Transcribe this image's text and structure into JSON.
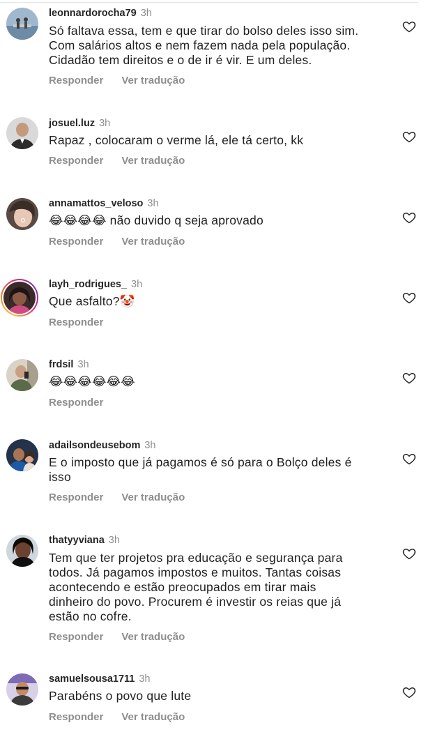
{
  "common": {
    "reply_label": "Responder",
    "translate_label": "Ver tradução",
    "heart_icon": "heart-outline-icon",
    "muted_color": "#8e8e8e"
  },
  "comments": [
    {
      "username": "leonnardorocha79",
      "time": "3h",
      "text": "Só faltava essa, tem e que tirar do bolso deles isso sim.\nCom salários altos e nem fazem nada pela população.\nCidadão tem direitos e o de ir é vir. E um deles.",
      "has_translate": true
    },
    {
      "username": "josuel.luz",
      "time": "3h",
      "text": "Rapaz , colocaram o verme lá, ele tá certo, kk",
      "has_translate": true
    },
    {
      "username": "annamattos_veloso",
      "time": "3h",
      "text": "😂😂😂😂 não duvido q seja aprovado",
      "has_translate": true
    },
    {
      "username": "layh_rodrigues_",
      "time": "3h",
      "text": "Que asfalto?🤡",
      "has_translate": false
    },
    {
      "username": "frdsil",
      "time": "3h",
      "text": "😂😂😂😂😂😂",
      "has_translate": false
    },
    {
      "username": "adailsondeusebom",
      "time": "3h",
      "text": "E o imposto que já pagamos é só para o Bolço deles é\nisso",
      "has_translate": true
    },
    {
      "username": "thatyyviana",
      "time": "3h",
      "text": "Tem que ter projetos pra educação e segurança para\ntodos. Já pagamos impostos e muitos. Tantas coisas\nacontecendo e estão preocupados em tirar mais\ndinheiro do povo. Procurem é investir os reias que já\nestão no cofre.",
      "has_translate": true
    },
    {
      "username": "samuelsousa1711",
      "time": "3h",
      "text": "Parabéns o povo que lute",
      "has_translate": true
    }
  ]
}
